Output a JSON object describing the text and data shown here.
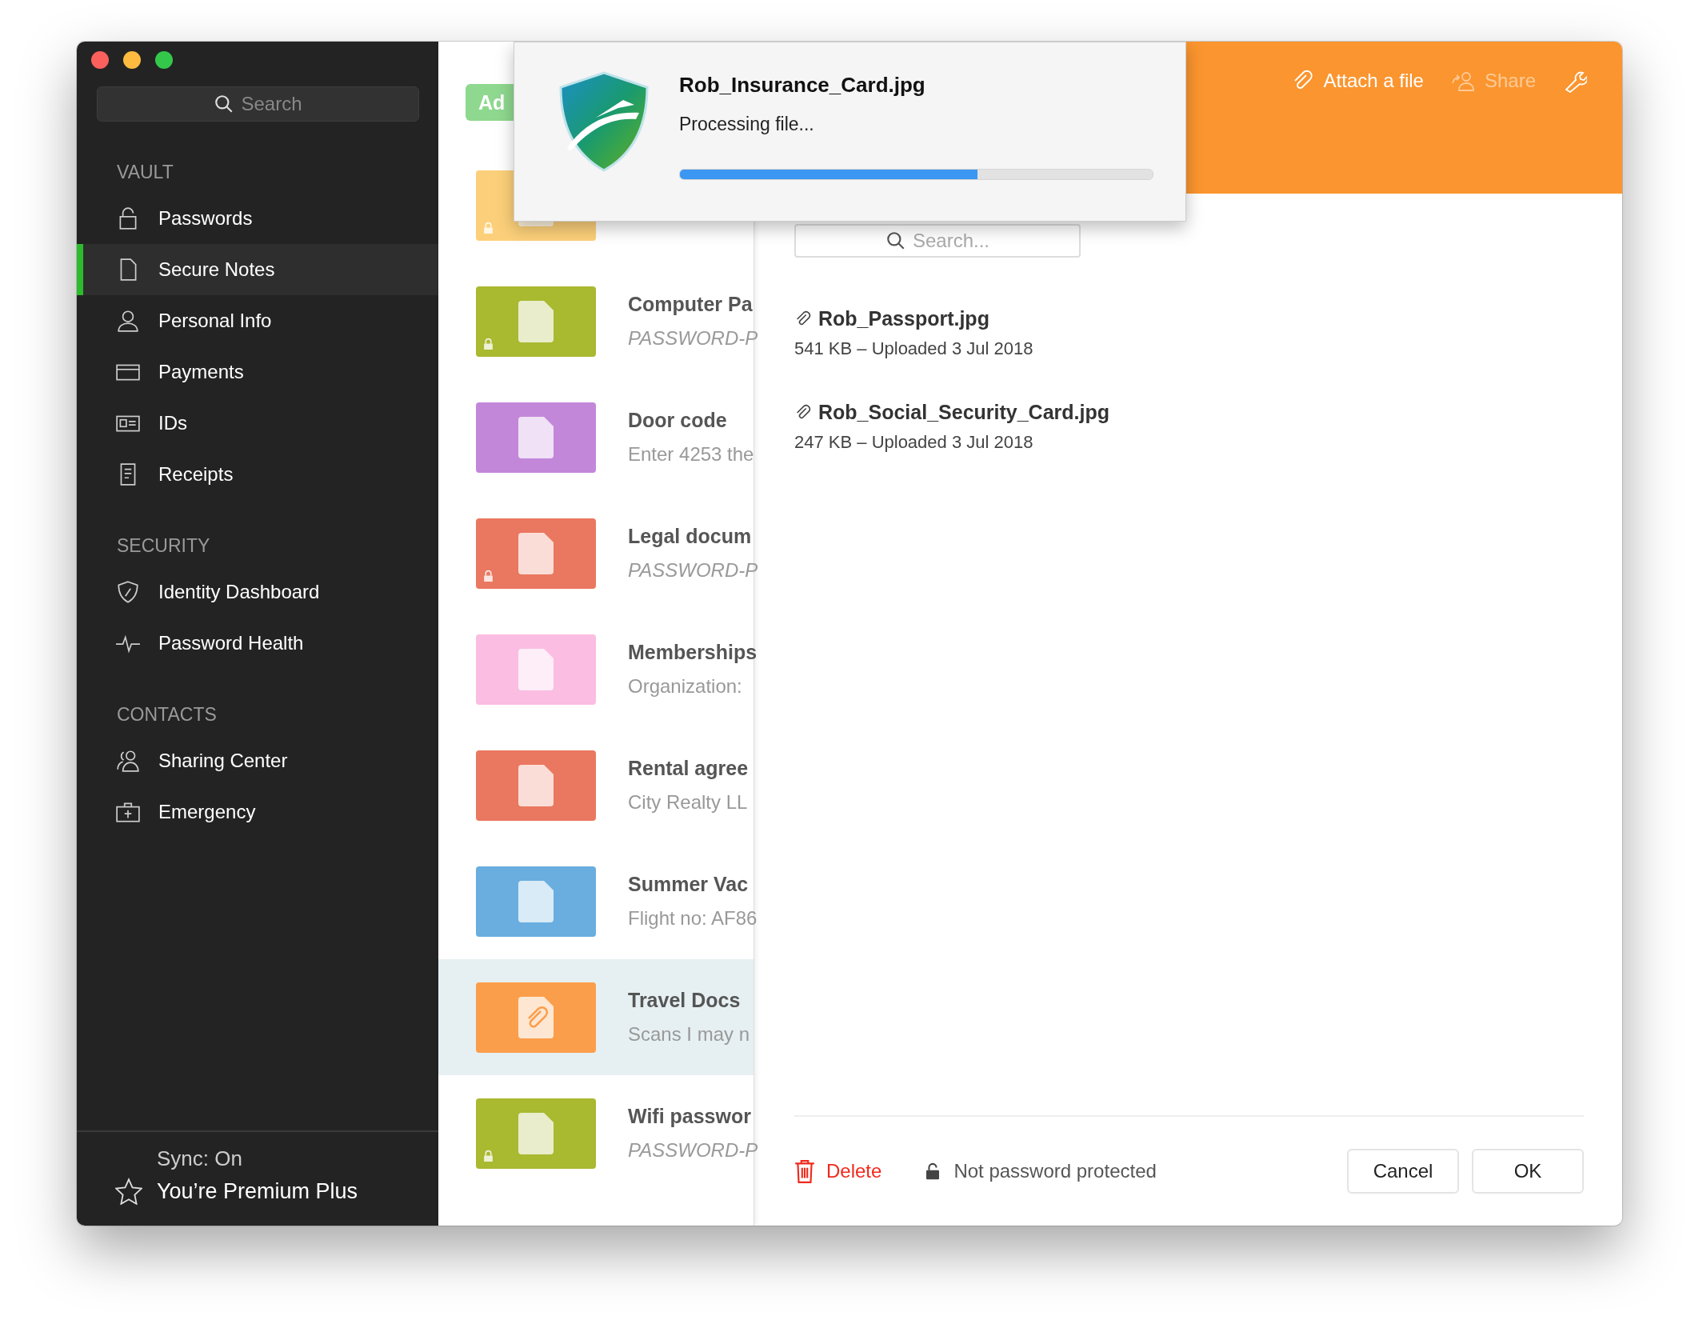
{
  "sidebar": {
    "search": {
      "placeholder": "Search"
    },
    "sections": [
      {
        "heading": "VAULT",
        "items": [
          {
            "label": "Passwords",
            "selected": false
          },
          {
            "label": "Secure Notes",
            "selected": true
          },
          {
            "label": "Personal Info",
            "selected": false
          },
          {
            "label": "Payments",
            "selected": false
          },
          {
            "label": "IDs",
            "selected": false
          },
          {
            "label": "Receipts",
            "selected": false
          }
        ]
      },
      {
        "heading": "SECURITY",
        "items": [
          {
            "label": "Identity Dashboard",
            "selected": false
          },
          {
            "label": "Password Health",
            "selected": false
          }
        ]
      },
      {
        "heading": "CONTACTS",
        "items": [
          {
            "label": "Sharing Center",
            "selected": false
          },
          {
            "label": "Emergency",
            "selected": false
          }
        ]
      }
    ],
    "sync_status": "Sync: On",
    "plan": "You’re Premium Plus"
  },
  "notes_list": {
    "add_button": "Ad",
    "items": [
      {
        "color": "#fcd07a",
        "locked": true,
        "attachment": false,
        "selected": false
      },
      {
        "title": "Computer Pa",
        "subtitle": "PASSWORD-P",
        "color": "#a9b930",
        "locked": true,
        "attachment": false,
        "selected": false
      },
      {
        "title": "Door code",
        "subtitle": "Enter 4253 the",
        "color": "#c387da",
        "locked": false,
        "attachment": false,
        "selected": false
      },
      {
        "title": "Legal docum",
        "subtitle": "PASSWORD-P",
        "color": "#ea775f",
        "locked": true,
        "attachment": false,
        "selected": false
      },
      {
        "title": "Memberships",
        "subtitle": "Organization:",
        "color": "#fbbde1",
        "locked": false,
        "attachment": false,
        "selected": false
      },
      {
        "title": "Rental agree",
        "subtitle": "City Realty LL",
        "color": "#ea775f",
        "locked": false,
        "attachment": false,
        "selected": false
      },
      {
        "title": "Summer Vac",
        "subtitle": "Flight no: AF86",
        "color": "#6aaee0",
        "locked": false,
        "attachment": false,
        "selected": false
      },
      {
        "title": "Travel Docs",
        "subtitle": "Scans I may n",
        "color": "#fb9e4b",
        "locked": false,
        "attachment": true,
        "selected": true
      },
      {
        "title": "Wifi passwor",
        "subtitle": "PASSWORD-P",
        "color": "#a9b930",
        "locked": true,
        "attachment": false,
        "selected": false
      }
    ]
  },
  "detail": {
    "toolbar": [
      {
        "kind": "attach",
        "label": "Attach a file",
        "disabled": false
      },
      {
        "kind": "share",
        "label": "Share",
        "disabled": true
      },
      {
        "kind": "settings",
        "disabled": false
      }
    ],
    "search": {
      "placeholder": "Search..."
    },
    "attachments": [
      {
        "name": "Rob_Passport.jpg",
        "meta": "541 KB – Uploaded 3 Jul 2018"
      },
      {
        "name": "Rob_Social_Security_Card.jpg",
        "meta": "247 KB – Uploaded 3 Jul 2018"
      }
    ],
    "delete_button": "Delete",
    "protection": "Not password protected",
    "cancel_button": "Cancel",
    "ok_button": "OK"
  },
  "upload_dialog": {
    "file_name": "Rob_Insurance_Card.jpg",
    "status": "Processing file...",
    "level": 0.63
  }
}
